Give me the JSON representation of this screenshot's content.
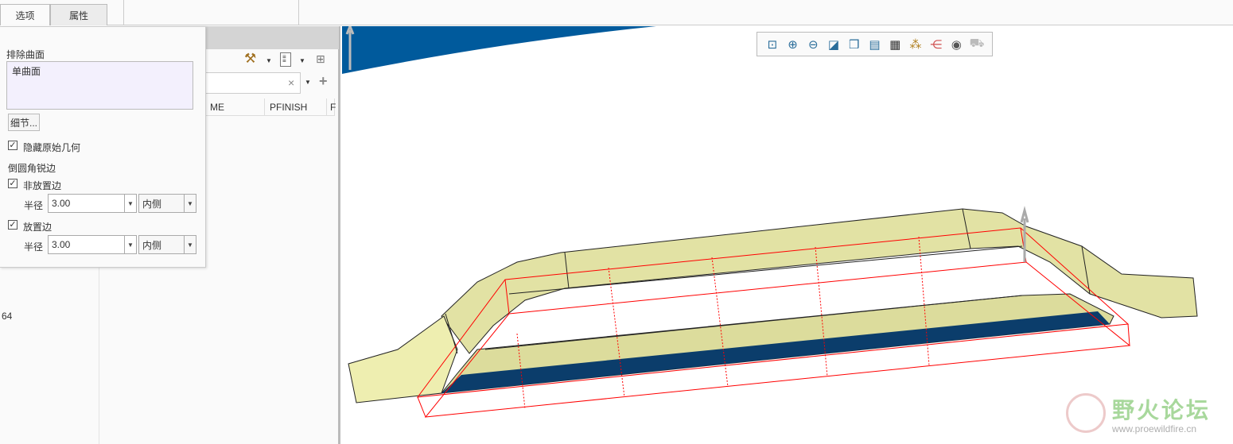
{
  "tabs": [
    {
      "label": "选项"
    },
    {
      "label": "属性"
    }
  ],
  "options_panel": {
    "exclude_surfaces_label": "排除曲面",
    "exclude_surfaces_items": [
      "单曲面"
    ],
    "details_button": "细节...",
    "hide_original_label": "隐藏原始几何",
    "hide_original_checked": true,
    "round_sharp_edges_label": "倒圆角锐边",
    "non_placement_edges": {
      "label": "非放置边",
      "checked": true,
      "radius_label": "半径",
      "radius": "3.00",
      "side": "内侧"
    },
    "placement_edges": {
      "label": "放置边",
      "checked": true,
      "radius_label": "半径",
      "radius": "3.00",
      "side": "内侧"
    }
  },
  "model_tree": {
    "columns": [
      "ME",
      "PFINISH",
      "F"
    ],
    "search_clear": "×",
    "add": "+",
    "left_value": "64"
  },
  "view_toolbar": {
    "icons": [
      "refit-icon",
      "zoom-in-icon",
      "zoom-out-icon",
      "repaint-icon",
      "display-style-icon",
      "saved-views-icon",
      "view-manager-icon",
      "datum-display-icon",
      "spin-center-icon",
      "annotation-display-icon",
      "simulation-display-icon"
    ]
  },
  "watermark": {
    "title": "野火论坛",
    "url": "www.proewildfire.cn"
  },
  "colors": {
    "model_fill": "#e2e2a4",
    "highlight_blue": "#0b3d6b",
    "preview_red": "#ff0000",
    "viewport_blue": "#005a9c"
  }
}
